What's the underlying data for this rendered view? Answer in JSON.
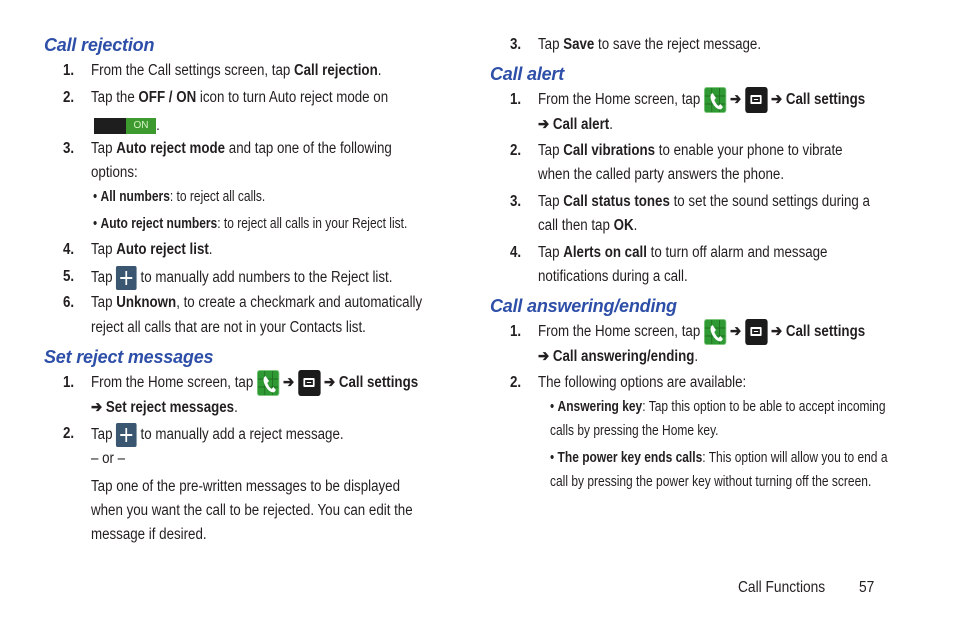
{
  "left": {
    "call_rejection": {
      "heading": "Call rejection",
      "step1": {
        "num": "1.",
        "pre": "From the Call settings screen, tap ",
        "bold": "Call rejection",
        "post": "."
      },
      "step2": {
        "num": "2.",
        "pre": "Tap the ",
        "bold": "OFF / ON",
        "post": " icon to turn Auto reject mode on",
        "toggle_label": "ON",
        "toggle_state": "on",
        "end": "."
      },
      "step3": {
        "num": "3.",
        "pre": "Tap ",
        "bold": "Auto reject mode",
        "post": " and tap one of the following",
        "line2": "options:"
      },
      "bullets": [
        {
          "bold": "All numbers",
          "text": ": to reject all calls."
        },
        {
          "bold": "Auto reject numbers",
          "text": ": to reject all calls in your Reject list."
        }
      ],
      "step4": {
        "num": "4.",
        "pre": "Tap ",
        "bold": "Auto reject list",
        "post": "."
      },
      "step5": {
        "num": "5.",
        "pre": "Tap ",
        "icon": "plus-icon",
        "post": " to manually add numbers to the Reject list."
      },
      "step6": {
        "num": "6.",
        "pre": "Tap ",
        "bold": "Unknown",
        "post": ", to create a checkmark and automatically",
        "line2": "reject all calls that are not in your Contacts list."
      }
    },
    "set_reject": {
      "heading": "Set reject messages",
      "step1": {
        "num": "1.",
        "pre": "From the Home screen, tap ",
        "arrow": "➔",
        "bold1": "Call settings",
        "bold2": "Set reject messages",
        "post": "."
      },
      "step2": {
        "num": "2.",
        "pre": "Tap ",
        "post": " to manually add a reject message.",
        "or": "– or –",
        "para": [
          "Tap one of the pre-written messages to be displayed",
          "when you want the call to be rejected. You can edit the",
          "message if desired."
        ]
      }
    }
  },
  "right": {
    "step3": {
      "num": "3.",
      "pre": "Tap ",
      "bold": "Save",
      "post": " to save the reject message."
    },
    "call_alert": {
      "heading": "Call alert",
      "step1": {
        "num": "1.",
        "pre": "From the Home screen, tap ",
        "arrow": "➔",
        "bold1": "Call settings",
        "bold2": "Call alert",
        "post": "."
      },
      "step2": {
        "num": "2.",
        "pre": "Tap ",
        "bold": "Call vibrations",
        "post": " to enable your phone to vibrate",
        "line2": "when the called party answers the phone."
      },
      "step3": {
        "num": "3.",
        "pre": "Tap ",
        "bold": "Call status tones",
        "post": " to set the sound settings during a",
        "line2a": "call then tap ",
        "line2bold": "OK",
        "line2post": "."
      },
      "step4": {
        "num": "4.",
        "pre": "Tap ",
        "bold": "Alerts on call",
        "post": " to turn off alarm and message",
        "line2": "notifications during a call."
      }
    },
    "call_answering": {
      "heading": "Call answering/ending",
      "step1": {
        "num": "1.",
        "pre": "From the Home screen, tap ",
        "arrow": "➔",
        "bold1": "Call settings",
        "bold2": "Call answering/ending",
        "post": "."
      },
      "step2": {
        "num": "2.",
        "text": "The following options are available:"
      },
      "bullets": [
        {
          "bold": "Answering key",
          "text": ": Tap this option to be able to accept incoming",
          "line2": "calls by pressing the Home key."
        },
        {
          "bold": "The power key ends calls",
          "text": ": This option will allow you to end a",
          "line2": "call by pressing the power key without turning off the screen."
        }
      ]
    }
  },
  "footer": {
    "section": "Call Functions",
    "page": "57"
  }
}
